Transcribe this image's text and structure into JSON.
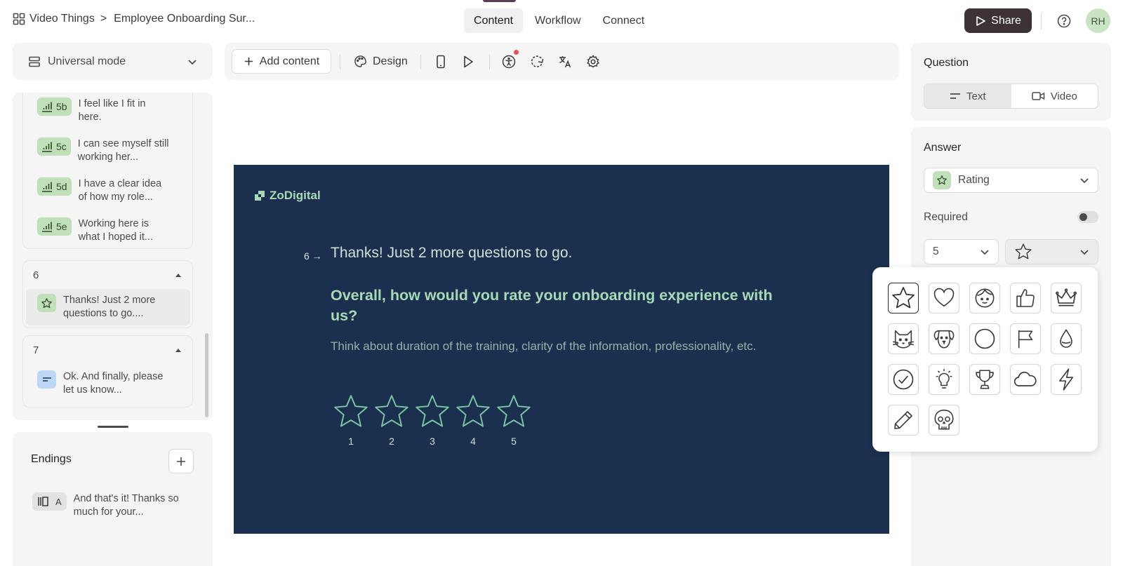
{
  "topbar": {
    "breadcrumb": [
      "Video Things",
      "Employee Onboarding Sur..."
    ],
    "breadcrumb_separator": ">",
    "tabs": [
      "Content",
      "Workflow",
      "Connect"
    ],
    "active_tab": "Content",
    "share_label": "Share",
    "avatar_initials": "RH"
  },
  "sidebar": {
    "mode_label": "Universal mode",
    "group5_items": [
      {
        "badge": "5b",
        "text": "I feel like I fit in here."
      },
      {
        "badge": "5c",
        "text": "I can see myself still working her..."
      },
      {
        "badge": "5d",
        "text": "I have a clear idea of how my role..."
      },
      {
        "badge": "5e",
        "text": "Working here is what I hoped it..."
      }
    ],
    "group6": {
      "number": "6",
      "item_text": "Thanks! Just 2 more questions to go...."
    },
    "group7": {
      "number": "7",
      "item_text": "Ok. And finally, please let us know..."
    },
    "endings_title": "Endings",
    "ending_item": {
      "badge": "A",
      "text": "And that's it! Thanks so much for your..."
    }
  },
  "toolbar": {
    "add_content_label": "Add content",
    "design_label": "Design"
  },
  "slide": {
    "logo_text": "ZoDigital",
    "question_number": "6",
    "question_title": "Thanks! Just 2 more questions to go.",
    "heading": "Overall, how would you rate your onboarding experience with us?",
    "description": "Think about duration of the training, clarity of the information, professionality, etc.",
    "rating_labels": [
      "1",
      "2",
      "3",
      "4",
      "5"
    ],
    "background_color": "#1b304f",
    "accent_color": "#a8d9b5"
  },
  "right_panel": {
    "question_title": "Question",
    "question_options": [
      "Text",
      "Video"
    ],
    "question_selected": "Text",
    "answer_title": "Answer",
    "answer_type": "Rating",
    "required_label": "Required",
    "required_on": false,
    "scale_value": "5",
    "selected_icon": "star-icon"
  },
  "icon_picker": {
    "icons": [
      "star-icon",
      "heart-icon",
      "face-icon",
      "thumbs-up-icon",
      "crown-icon",
      "cat-icon",
      "dog-icon",
      "circle-icon",
      "flag-icon",
      "drop-icon",
      "check-circle-icon",
      "lightbulb-icon",
      "trophy-icon",
      "cloud-icon",
      "lightning-icon",
      "pencil-icon",
      "skull-icon"
    ],
    "selected": "star-icon"
  }
}
